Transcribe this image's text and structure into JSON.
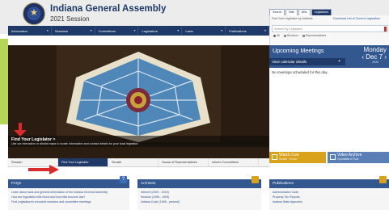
{
  "header": {
    "title": "Indiana General Assembly",
    "session": "2021 Session"
  },
  "tabs": [
    {
      "label": "Search",
      "active": false
    },
    {
      "label": "Bills",
      "active": false
    },
    {
      "label": "Bills",
      "active": false
    },
    {
      "label": "Legislators",
      "active": true
    }
  ],
  "legislator_search": {
    "who_label": "Find Your Legislator by Address",
    "who_link": "Download List of Current Legislators",
    "placeholder": "Search By Legislator",
    "radios": [
      {
        "label": "All",
        "selected": true
      },
      {
        "label": "Senators",
        "selected": false
      },
      {
        "label": "Representatives",
        "selected": false
      }
    ]
  },
  "nav": [
    "Information",
    "Sessions",
    "Committees",
    "Legislators",
    "Laws",
    "Publications"
  ],
  "hero": {
    "title": "Find Your Legislator >",
    "text": "Use our interactive or district maps to locate information and contact details for your local legislator.",
    "tabs": [
      {
        "label": "Session",
        "active": false
      },
      {
        "label": "Find Your Legislator",
        "active": true
      },
      {
        "label": "Senate",
        "active": false
      },
      {
        "label": "House of Representatives",
        "active": false
      },
      {
        "label": "Interim Committees",
        "active": false
      }
    ]
  },
  "meetings": {
    "title": "Upcoming Meetings",
    "day": "Monday",
    "date": "Dec 7",
    "year": "2020",
    "calendar_label": "View calendar details",
    "no_meetings": "No meetings scheduled for this day.",
    "live": {
      "label": "Watch Live",
      "sub": "Senate · House"
    },
    "archive": {
      "label": "Video Archive",
      "sub": "Committee & Floor"
    }
  },
  "panels": [
    {
      "title": "FAQs",
      "icon_color": "#3a6fb5",
      "icon": "question-icon",
      "lines": [
        "Learn about laws and general information of the Indiana General Assembly",
        "How are legislative bills found and how bills become law?",
        "Find Legislature's recorded sessions and committee meetings"
      ]
    },
    {
      "title": "Archives",
      "icon_color": "#d9a21b",
      "icon": "archive-icon",
      "lines": [
        "Internet (2000 - 2019)",
        "Session (1998 - 1999)",
        "Indiana Code (1998 - present)"
      ]
    },
    {
      "title": "Publications",
      "icon_color": "#d9a21b",
      "icon": "pencil-icon",
      "lines": [
        "Administrative Code",
        "Property Tax Reports",
        "Indiana State Agencies"
      ]
    }
  ]
}
